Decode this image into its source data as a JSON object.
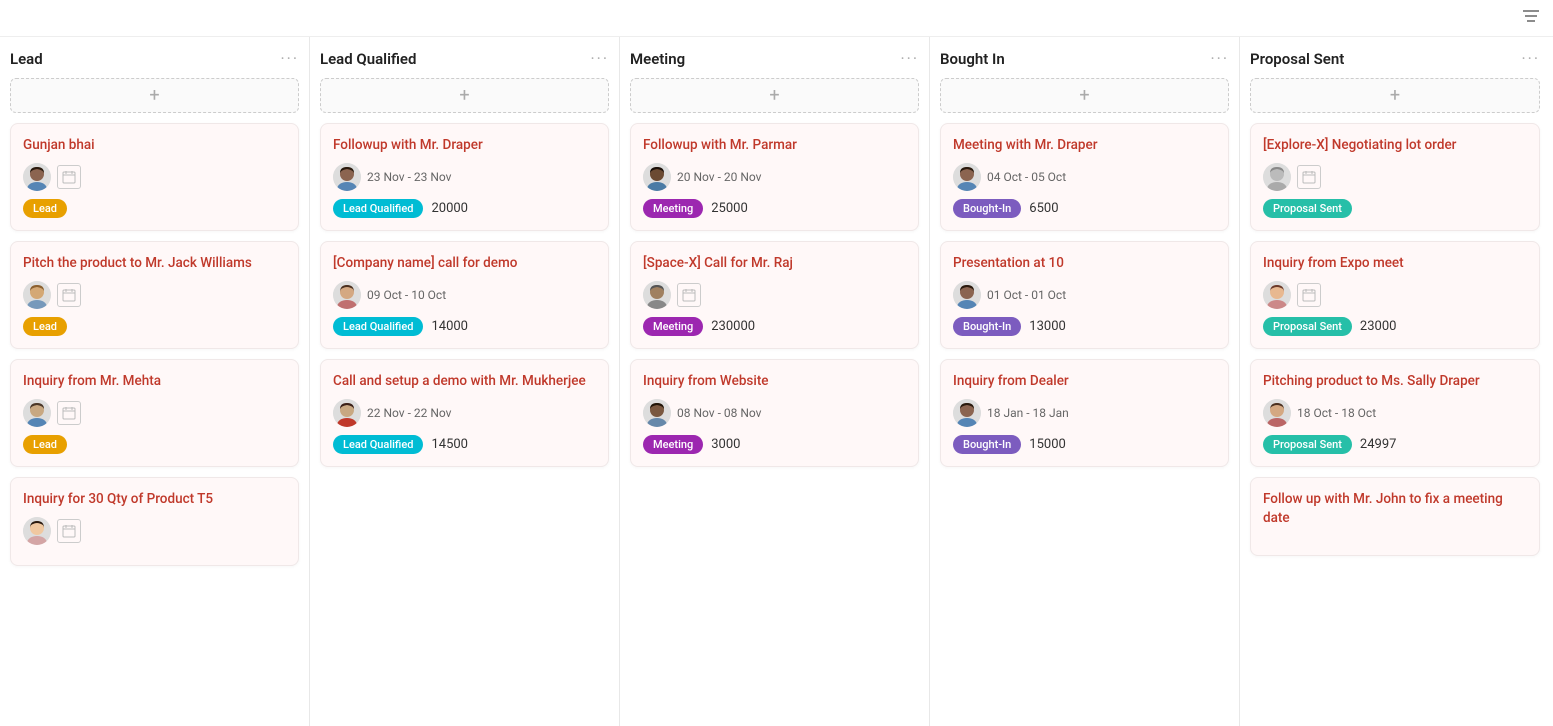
{
  "topbar": {
    "filter_icon": "≡"
  },
  "columns": [
    {
      "id": "lead",
      "title": "Lead",
      "add_label": "+",
      "cards": [
        {
          "id": "c1",
          "title": "Gunjan bhai",
          "has_avatar": true,
          "avatar_type": "male_dark",
          "has_calendar": true,
          "badge": "Lead",
          "badge_type": "lead",
          "amount": null,
          "date": null
        },
        {
          "id": "c2",
          "title": "Pitch the product to Mr. Jack Williams",
          "has_avatar": true,
          "avatar_type": "male_light",
          "has_calendar": true,
          "badge": "Lead",
          "badge_type": "lead",
          "amount": null,
          "date": null
        },
        {
          "id": "c3",
          "title": "Inquiry from Mr. Mehta",
          "has_avatar": true,
          "avatar_type": "male_medium",
          "has_calendar": true,
          "badge": "Lead",
          "badge_type": "lead",
          "amount": null,
          "date": null
        },
        {
          "id": "c4",
          "title": "Inquiry for 30 Qty of Product T5",
          "has_avatar": true,
          "avatar_type": "female_light",
          "has_calendar": true,
          "badge": null,
          "badge_type": null,
          "amount": null,
          "date": null
        }
      ]
    },
    {
      "id": "lead-qualified",
      "title": "Lead Qualified",
      "add_label": "+",
      "cards": [
        {
          "id": "c5",
          "title": "Followup with Mr. Draper",
          "has_avatar": true,
          "avatar_type": "male_dark",
          "has_calendar": false,
          "date": "23 Nov - 23 Nov",
          "badge": "Lead Qualified",
          "badge_type": "lead-qualified",
          "amount": "20000"
        },
        {
          "id": "c6",
          "title": "[Company name] call for demo",
          "has_avatar": true,
          "avatar_type": "female_medium",
          "has_calendar": false,
          "date": "09 Oct - 10 Oct",
          "badge": "Lead Qualified",
          "badge_type": "lead-qualified",
          "amount": "14000"
        },
        {
          "id": "c7",
          "title": "Call and setup a demo with Mr. Mukherjee",
          "has_avatar": true,
          "avatar_type": "male_red",
          "has_calendar": false,
          "date": "22 Nov - 22 Nov",
          "badge": "Lead Qualified",
          "badge_type": "lead-qualified",
          "amount": "14500"
        }
      ]
    },
    {
      "id": "meeting",
      "title": "Meeting",
      "add_label": "+",
      "cards": [
        {
          "id": "c8",
          "title": "Followup with Mr. Parmar",
          "has_avatar": true,
          "avatar_type": "male_dark2",
          "has_calendar": false,
          "date": "20 Nov - 20 Nov",
          "badge": "Meeting",
          "badge_type": "meeting",
          "amount": "25000"
        },
        {
          "id": "c9",
          "title": "[Space-X] Call for Mr. Raj",
          "has_avatar": true,
          "avatar_type": "male_gray",
          "has_calendar": true,
          "date": null,
          "badge": "Meeting",
          "badge_type": "meeting",
          "amount": "230000"
        },
        {
          "id": "c10",
          "title": "Inquiry from Website",
          "has_avatar": true,
          "avatar_type": "male_dark3",
          "has_calendar": false,
          "date": "08 Nov - 08 Nov",
          "badge": "Meeting",
          "badge_type": "meeting",
          "amount": "3000"
        }
      ]
    },
    {
      "id": "bought-in",
      "title": "Bought In",
      "add_label": "+",
      "cards": [
        {
          "id": "c11",
          "title": "Meeting with Mr. Draper",
          "has_avatar": true,
          "avatar_type": "male_dark",
          "has_calendar": false,
          "date": "04 Oct - 05 Oct",
          "badge": "Bought-In",
          "badge_type": "bought-in",
          "amount": "6500"
        },
        {
          "id": "c12",
          "title": "Presentation at 10",
          "has_avatar": true,
          "avatar_type": "male_dark",
          "has_calendar": false,
          "date": "01 Oct - 01 Oct",
          "badge": "Bought-In",
          "badge_type": "bought-in",
          "amount": "13000"
        },
        {
          "id": "c13",
          "title": "Inquiry from Dealer",
          "has_avatar": true,
          "avatar_type": "male_dark",
          "has_calendar": false,
          "date": "18 Jan - 18 Jan",
          "badge": "Bought-In",
          "badge_type": "bought-in",
          "amount": "15000"
        }
      ]
    },
    {
      "id": "proposal-sent",
      "title": "Proposal Sent",
      "add_label": "+",
      "cards": [
        {
          "id": "c14",
          "title": "[Explore-X] Negotiating lot order",
          "has_avatar": true,
          "avatar_type": "male_gray2",
          "has_calendar": true,
          "date": null,
          "badge": "Proposal Sent",
          "badge_type": "proposal-sent",
          "amount": null
        },
        {
          "id": "c15",
          "title": "Inquiry from Expo meet",
          "has_avatar": true,
          "avatar_type": "female_light2",
          "has_calendar": true,
          "date": null,
          "badge": "Proposal Sent",
          "badge_type": "proposal-sent",
          "amount": "23000"
        },
        {
          "id": "c16",
          "title": "Pitching product to Ms. Sally Draper",
          "has_avatar": true,
          "avatar_type": "female_medium2",
          "has_calendar": false,
          "date": "18 Oct - 18 Oct",
          "badge": "Proposal Sent",
          "badge_type": "proposal-sent",
          "amount": "24997"
        },
        {
          "id": "c17",
          "title": "Follow up with Mr. John to fix a meeting date",
          "has_avatar": false,
          "avatar_type": null,
          "has_calendar": false,
          "date": null,
          "badge": null,
          "badge_type": null,
          "amount": null
        }
      ]
    }
  ]
}
